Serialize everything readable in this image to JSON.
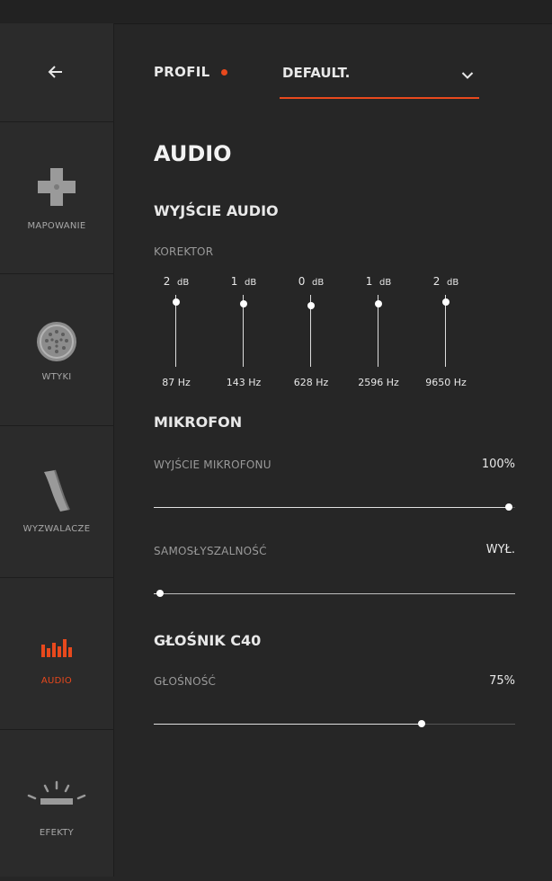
{
  "sidebar": {
    "back_icon": "arrow-left-icon",
    "items": [
      {
        "label": "MAPOWANIE",
        "icon": "dpad-icon",
        "active": false
      },
      {
        "label": "WTYKI",
        "icon": "connector-icon",
        "active": false
      },
      {
        "label": "WYZWALACZE",
        "icon": "trigger-icon",
        "active": false
      },
      {
        "label": "AUDIO",
        "icon": "audio-bars-icon",
        "active": true
      },
      {
        "label": "EFEKTY",
        "icon": "light-effects-icon",
        "active": false
      }
    ]
  },
  "profile": {
    "label": "PROFIL",
    "value": "DEFAULT."
  },
  "main": {
    "section_title": "AUDIO",
    "audio_output": {
      "title": "WYJŚCIE AUDIO",
      "equalizer_label": "KOREKTOR",
      "db_unit": "dB",
      "db_range": [
        -6,
        6
      ],
      "bands": [
        {
          "db": "2",
          "freq": "87 Hz",
          "level": 2
        },
        {
          "db": "1",
          "freq": "143 Hz",
          "level": 1
        },
        {
          "db": "0",
          "freq": "628 Hz",
          "level": 0
        },
        {
          "db": "1",
          "freq": "2596 Hz",
          "level": 1
        },
        {
          "db": "2",
          "freq": "9650 Hz",
          "level": 2
        }
      ]
    },
    "microphone": {
      "title": "MIKROFON",
      "output_label": "WYJŚCIE MIKROFONU",
      "output_value": "100%",
      "output_level": 1.0,
      "sidetone_label": "SAMOSŁYSZALNOŚĆ",
      "sidetone_value": "WYŁ.",
      "sidetone_level": 0.0
    },
    "speaker": {
      "title": "GŁOŚNIK C40",
      "volume_label": "GŁOŚNOŚĆ",
      "volume_value": "75%",
      "volume_level": 0.75
    }
  },
  "colors": {
    "accent": "#e8491d",
    "background": "#262626",
    "sidebar": "#2b2b2b"
  }
}
